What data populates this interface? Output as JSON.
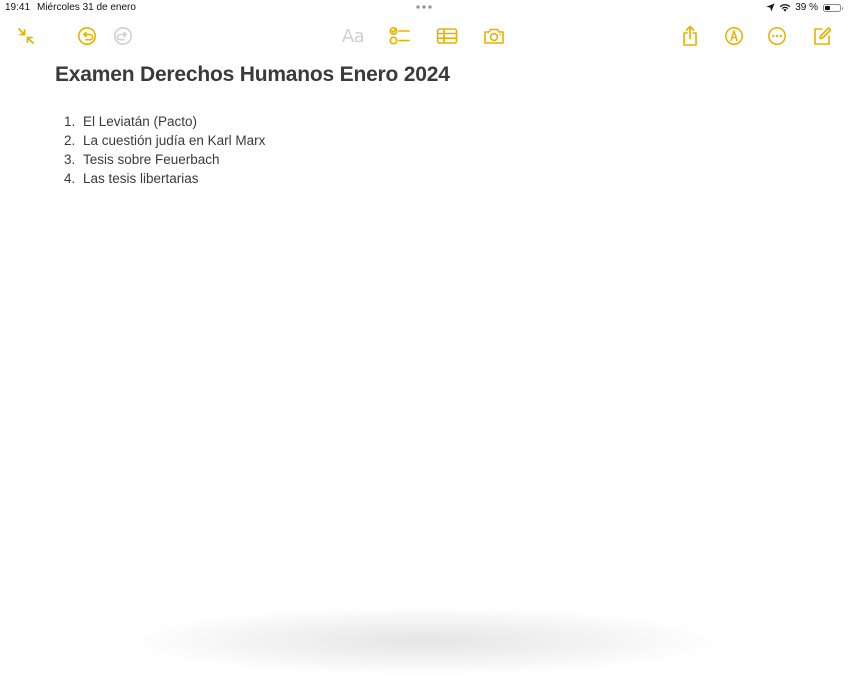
{
  "status_bar": {
    "time": "19:41",
    "date": "Miércoles 31 de enero",
    "battery_percent": "39 %",
    "battery_level": 0.39
  },
  "toolbar": {
    "left_icons": [
      "collapse-icon",
      "undo-icon",
      "redo-icon"
    ],
    "format_label": "Aa",
    "center_icons": [
      "checklist-icon",
      "table-icon",
      "camera-icon"
    ],
    "right_icons": [
      "share-icon",
      "markup-icon",
      "more-icon",
      "compose-icon"
    ],
    "accent_color": "#e8b000",
    "disabled_color": "#cfcfcf"
  },
  "note": {
    "title": "Examen Derechos Humanos Enero 2024",
    "items": [
      {
        "number": "1.",
        "text": "El Leviatán (Pacto)"
      },
      {
        "number": "2.",
        "text": "La cuestión judía en Karl Marx"
      },
      {
        "number": "3.",
        "text": "Tesis sobre Feuerbach"
      },
      {
        "number": "4.",
        "text": "Las tesis libertarias"
      }
    ]
  }
}
